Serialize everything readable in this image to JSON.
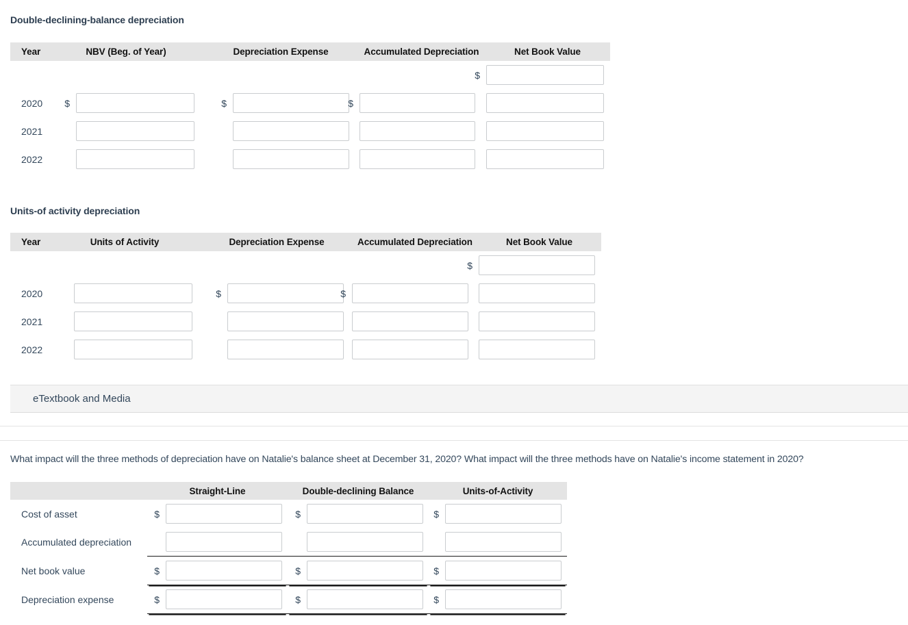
{
  "ddb_section": {
    "title": "Double-declining-balance depreciation",
    "columns": [
      "Year",
      "NBV (Beg. of Year)",
      "Depreciation Expense",
      "Accumulated Depreciation",
      "Net Book Value"
    ],
    "rows": [
      {
        "year": "",
        "cells": [
          {
            "dollar": "",
            "value": "",
            "placeholder": "",
            "visible": false
          },
          {
            "dollar": "",
            "value": "",
            "placeholder": "",
            "visible": false
          },
          {
            "dollar": "",
            "value": "",
            "placeholder": "",
            "visible": false
          },
          {
            "dollar": "$",
            "value": "",
            "placeholder": "",
            "visible": true
          }
        ]
      },
      {
        "year": "2020",
        "cells": [
          {
            "dollar": "$",
            "value": "",
            "placeholder": "",
            "visible": true
          },
          {
            "dollar": "$",
            "value": "",
            "placeholder": "",
            "visible": true
          },
          {
            "dollar": "$",
            "value": "",
            "placeholder": "",
            "visible": true
          },
          {
            "dollar": "",
            "value": "",
            "placeholder": "",
            "visible": true
          }
        ]
      },
      {
        "year": "2021",
        "cells": [
          {
            "dollar": "",
            "value": "",
            "placeholder": "",
            "visible": true
          },
          {
            "dollar": "",
            "value": "",
            "placeholder": "",
            "visible": true
          },
          {
            "dollar": "",
            "value": "",
            "placeholder": "",
            "visible": true
          },
          {
            "dollar": "",
            "value": "",
            "placeholder": "",
            "visible": true
          }
        ]
      },
      {
        "year": "2022",
        "cells": [
          {
            "dollar": "",
            "value": "",
            "placeholder": "",
            "visible": true
          },
          {
            "dollar": "",
            "value": "",
            "placeholder": "",
            "visible": true
          },
          {
            "dollar": "",
            "value": "",
            "placeholder": "",
            "visible": true
          },
          {
            "dollar": "",
            "value": "",
            "placeholder": "",
            "visible": true
          }
        ]
      }
    ]
  },
  "uoa_section": {
    "title": "Units-of activity depreciation",
    "columns": [
      "Year",
      "Units of Activity",
      "Depreciation Expense",
      "Accumulated Depreciation",
      "Net Book Value"
    ],
    "rows": [
      {
        "year": "",
        "cells": [
          {
            "dollar": "",
            "value": "",
            "placeholder": "",
            "visible": false
          },
          {
            "dollar": "",
            "value": "",
            "placeholder": "",
            "visible": false
          },
          {
            "dollar": "",
            "value": "",
            "placeholder": "",
            "visible": false
          },
          {
            "dollar": "$",
            "value": "",
            "placeholder": "",
            "visible": true
          }
        ]
      },
      {
        "year": "2020",
        "cells": [
          {
            "dollar": "",
            "value": "",
            "placeholder": "",
            "visible": true
          },
          {
            "dollar": "$",
            "value": "",
            "placeholder": "",
            "visible": true
          },
          {
            "dollar": "$",
            "value": "",
            "placeholder": "",
            "visible": true
          },
          {
            "dollar": "",
            "value": "",
            "placeholder": "",
            "visible": true
          }
        ]
      },
      {
        "year": "2021",
        "cells": [
          {
            "dollar": "",
            "value": "",
            "placeholder": "",
            "visible": true
          },
          {
            "dollar": "",
            "value": "",
            "placeholder": "",
            "visible": true
          },
          {
            "dollar": "",
            "value": "",
            "placeholder": "",
            "visible": true
          },
          {
            "dollar": "",
            "value": "",
            "placeholder": "",
            "visible": true
          }
        ]
      },
      {
        "year": "2022",
        "cells": [
          {
            "dollar": "",
            "value": "",
            "placeholder": "",
            "visible": true
          },
          {
            "dollar": "",
            "value": "",
            "placeholder": "",
            "visible": true
          },
          {
            "dollar": "",
            "value": "",
            "placeholder": "",
            "visible": true
          },
          {
            "dollar": "",
            "value": "",
            "placeholder": "",
            "visible": true
          }
        ]
      }
    ]
  },
  "etextbook": {
    "label": "eTextbook and Media"
  },
  "question": {
    "text": "What impact will the three methods of depreciation have on Natalie's balance sheet at December 31, 2020? What impact will the three methods have on Natalie's income statement in 2020?"
  },
  "compare_section": {
    "columns": [
      "",
      "Straight-Line",
      "Double-declining Balance",
      "Units-of-Activity"
    ],
    "rows": [
      {
        "label": "Cost of asset",
        "underline": "none",
        "cells": [
          {
            "dollar": "$",
            "value": "",
            "placeholder": ""
          },
          {
            "dollar": "$",
            "value": "",
            "placeholder": ""
          },
          {
            "dollar": "$",
            "value": "",
            "placeholder": ""
          }
        ]
      },
      {
        "label": "Accumulated depreciation",
        "underline": "single",
        "cells": [
          {
            "dollar": "",
            "value": "",
            "placeholder": ""
          },
          {
            "dollar": "",
            "value": "",
            "placeholder": ""
          },
          {
            "dollar": "",
            "value": "",
            "placeholder": ""
          }
        ]
      },
      {
        "label": "Net book value",
        "underline": "double",
        "cells": [
          {
            "dollar": "$",
            "value": "",
            "placeholder": ""
          },
          {
            "dollar": "$",
            "value": "",
            "placeholder": ""
          },
          {
            "dollar": "$",
            "value": "",
            "placeholder": ""
          }
        ]
      },
      {
        "label": "Depreciation expense",
        "underline": "double",
        "cells": [
          {
            "dollar": "$",
            "value": "",
            "placeholder": ""
          },
          {
            "dollar": "$",
            "value": "",
            "placeholder": ""
          },
          {
            "dollar": "$",
            "value": "",
            "placeholder": ""
          }
        ]
      }
    ]
  },
  "colors": {
    "header_bg": "#e4e4e4",
    "text": "#33475b",
    "input_border": "#c9cccf",
    "rule": "#1b1b1b",
    "etextbook_bg": "#f4f4f4"
  }
}
